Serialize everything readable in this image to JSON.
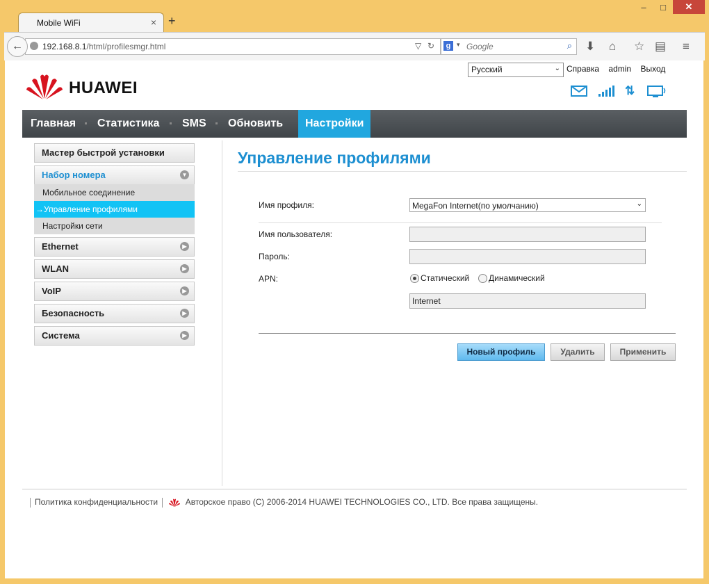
{
  "browser": {
    "tab_title": "Mobile WiFi",
    "tab_close": "×",
    "new_tab": "+",
    "url_host": "192.168.8.1",
    "url_path": "/html/profilesmgr.html",
    "search_placeholder": "Google",
    "search_engine_badge": "g"
  },
  "header": {
    "language": "Русский",
    "links": [
      "Справка",
      "admin",
      "Выход"
    ],
    "brand": "HUAWEI",
    "status_icons": [
      "mail-icon",
      "signal-icon",
      "data-transfer-icon",
      "monitor-icon"
    ]
  },
  "nav": {
    "items": [
      "Главная",
      "Статистика",
      "SMS",
      "Обновить",
      "Настройки"
    ],
    "active": "Настройки"
  },
  "sidebar": {
    "quick_setup": "Мастер быстрой установки",
    "dialup": "Набор номера",
    "dialup_items": [
      "Мобильное соединение",
      "→Управление профилями",
      "Настройки сети"
    ],
    "sections": [
      "Ethernet",
      "WLAN",
      "VoIP",
      "Безопасность",
      "Система"
    ]
  },
  "main": {
    "title": "Управление профилями",
    "profile_label": "Имя профиля:",
    "profile_value": "MegaFon Internet(по умолчанию)",
    "username_label": "Имя пользователя:",
    "username_value": "",
    "password_label": "Пароль:",
    "password_value": "",
    "apn_label": "APN:",
    "apn_static": "Статический",
    "apn_dynamic": "Динамический",
    "apn_value": "Internet",
    "btn_new": "Новый профиль",
    "btn_delete": "Удалить",
    "btn_apply": "Применить"
  },
  "footer": {
    "privacy": "Политика конфиденциальности",
    "copyright": "Авторское право (C) 2006-2014 HUAWEI TECHNOLOGIES CO., LTD. Все права защищены."
  },
  "colors": {
    "accent": "#1d8fd1",
    "nav_active": "#21a7df",
    "sidebar_active": "#12c3f5",
    "brand_red": "#d7131f"
  }
}
